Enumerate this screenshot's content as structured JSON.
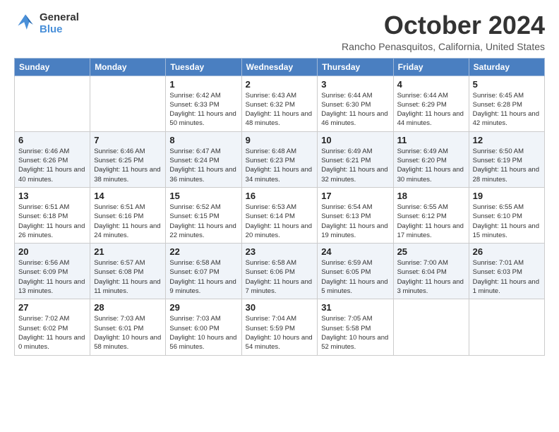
{
  "logo": {
    "line1": "General",
    "line2": "Blue"
  },
  "title": "October 2024",
  "subtitle": "Rancho Penasquitos, California, United States",
  "days_of_week": [
    "Sunday",
    "Monday",
    "Tuesday",
    "Wednesday",
    "Thursday",
    "Friday",
    "Saturday"
  ],
  "weeks": [
    [
      {
        "day": "",
        "info": ""
      },
      {
        "day": "",
        "info": ""
      },
      {
        "day": "1",
        "info": "Sunrise: 6:42 AM\nSunset: 6:33 PM\nDaylight: 11 hours and 50 minutes."
      },
      {
        "day": "2",
        "info": "Sunrise: 6:43 AM\nSunset: 6:32 PM\nDaylight: 11 hours and 48 minutes."
      },
      {
        "day": "3",
        "info": "Sunrise: 6:44 AM\nSunset: 6:30 PM\nDaylight: 11 hours and 46 minutes."
      },
      {
        "day": "4",
        "info": "Sunrise: 6:44 AM\nSunset: 6:29 PM\nDaylight: 11 hours and 44 minutes."
      },
      {
        "day": "5",
        "info": "Sunrise: 6:45 AM\nSunset: 6:28 PM\nDaylight: 11 hours and 42 minutes."
      }
    ],
    [
      {
        "day": "6",
        "info": "Sunrise: 6:46 AM\nSunset: 6:26 PM\nDaylight: 11 hours and 40 minutes."
      },
      {
        "day": "7",
        "info": "Sunrise: 6:46 AM\nSunset: 6:25 PM\nDaylight: 11 hours and 38 minutes."
      },
      {
        "day": "8",
        "info": "Sunrise: 6:47 AM\nSunset: 6:24 PM\nDaylight: 11 hours and 36 minutes."
      },
      {
        "day": "9",
        "info": "Sunrise: 6:48 AM\nSunset: 6:23 PM\nDaylight: 11 hours and 34 minutes."
      },
      {
        "day": "10",
        "info": "Sunrise: 6:49 AM\nSunset: 6:21 PM\nDaylight: 11 hours and 32 minutes."
      },
      {
        "day": "11",
        "info": "Sunrise: 6:49 AM\nSunset: 6:20 PM\nDaylight: 11 hours and 30 minutes."
      },
      {
        "day": "12",
        "info": "Sunrise: 6:50 AM\nSunset: 6:19 PM\nDaylight: 11 hours and 28 minutes."
      }
    ],
    [
      {
        "day": "13",
        "info": "Sunrise: 6:51 AM\nSunset: 6:18 PM\nDaylight: 11 hours and 26 minutes."
      },
      {
        "day": "14",
        "info": "Sunrise: 6:51 AM\nSunset: 6:16 PM\nDaylight: 11 hours and 24 minutes."
      },
      {
        "day": "15",
        "info": "Sunrise: 6:52 AM\nSunset: 6:15 PM\nDaylight: 11 hours and 22 minutes."
      },
      {
        "day": "16",
        "info": "Sunrise: 6:53 AM\nSunset: 6:14 PM\nDaylight: 11 hours and 20 minutes."
      },
      {
        "day": "17",
        "info": "Sunrise: 6:54 AM\nSunset: 6:13 PM\nDaylight: 11 hours and 19 minutes."
      },
      {
        "day": "18",
        "info": "Sunrise: 6:55 AM\nSunset: 6:12 PM\nDaylight: 11 hours and 17 minutes."
      },
      {
        "day": "19",
        "info": "Sunrise: 6:55 AM\nSunset: 6:10 PM\nDaylight: 11 hours and 15 minutes."
      }
    ],
    [
      {
        "day": "20",
        "info": "Sunrise: 6:56 AM\nSunset: 6:09 PM\nDaylight: 11 hours and 13 minutes."
      },
      {
        "day": "21",
        "info": "Sunrise: 6:57 AM\nSunset: 6:08 PM\nDaylight: 11 hours and 11 minutes."
      },
      {
        "day": "22",
        "info": "Sunrise: 6:58 AM\nSunset: 6:07 PM\nDaylight: 11 hours and 9 minutes."
      },
      {
        "day": "23",
        "info": "Sunrise: 6:58 AM\nSunset: 6:06 PM\nDaylight: 11 hours and 7 minutes."
      },
      {
        "day": "24",
        "info": "Sunrise: 6:59 AM\nSunset: 6:05 PM\nDaylight: 11 hours and 5 minutes."
      },
      {
        "day": "25",
        "info": "Sunrise: 7:00 AM\nSunset: 6:04 PM\nDaylight: 11 hours and 3 minutes."
      },
      {
        "day": "26",
        "info": "Sunrise: 7:01 AM\nSunset: 6:03 PM\nDaylight: 11 hours and 1 minute."
      }
    ],
    [
      {
        "day": "27",
        "info": "Sunrise: 7:02 AM\nSunset: 6:02 PM\nDaylight: 11 hours and 0 minutes."
      },
      {
        "day": "28",
        "info": "Sunrise: 7:03 AM\nSunset: 6:01 PM\nDaylight: 10 hours and 58 minutes."
      },
      {
        "day": "29",
        "info": "Sunrise: 7:03 AM\nSunset: 6:00 PM\nDaylight: 10 hours and 56 minutes."
      },
      {
        "day": "30",
        "info": "Sunrise: 7:04 AM\nSunset: 5:59 PM\nDaylight: 10 hours and 54 minutes."
      },
      {
        "day": "31",
        "info": "Sunrise: 7:05 AM\nSunset: 5:58 PM\nDaylight: 10 hours and 52 minutes."
      },
      {
        "day": "",
        "info": ""
      },
      {
        "day": "",
        "info": ""
      }
    ]
  ]
}
